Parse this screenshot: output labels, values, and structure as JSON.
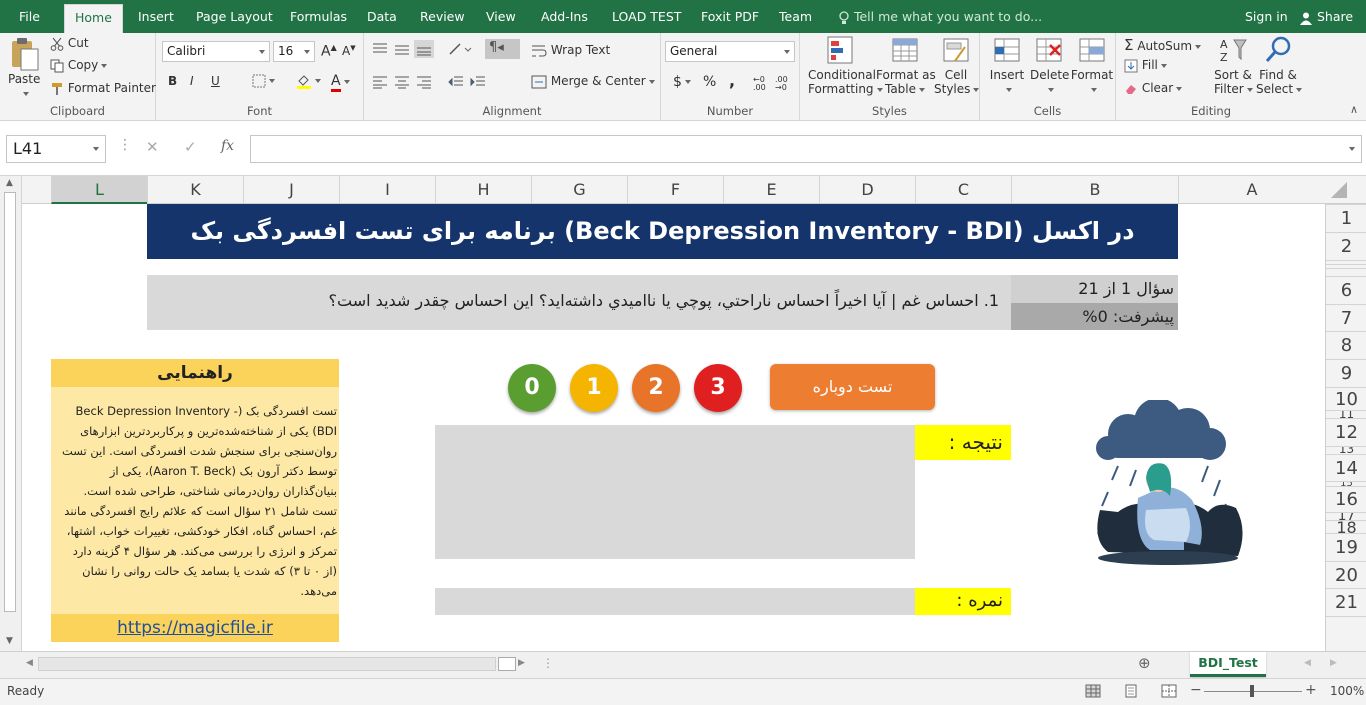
{
  "menu": {
    "tabs": [
      "File",
      "Home",
      "Insert",
      "Page Layout",
      "Formulas",
      "Data",
      "Review",
      "View",
      "Add-Ins",
      "LOAD TEST",
      "Foxit PDF",
      "Team"
    ],
    "tell_me": "Tell me what you want to do...",
    "sign_in": "Sign in",
    "share": "Share"
  },
  "ribbon": {
    "clipboard": {
      "label": "Clipboard",
      "paste": "Paste",
      "cut": "Cut",
      "copy": "Copy",
      "format_painter": "Format Painter"
    },
    "font": {
      "label": "Font",
      "name": "Calibri",
      "size": "16",
      "bold": "B",
      "italic": "I",
      "underline": "U"
    },
    "alignment": {
      "label": "Alignment",
      "wrap": "Wrap Text",
      "merge": "Merge & Center"
    },
    "number": {
      "label": "Number",
      "format": "General",
      "currency": "$",
      "percent": "%",
      "comma": ","
    },
    "styles": {
      "label": "Styles",
      "cond1": "Conditional",
      "cond2": "Formatting",
      "fmt1": "Format as",
      "fmt2": "Table",
      "cell1": "Cell",
      "cell2": "Styles"
    },
    "cells": {
      "label": "Cells",
      "insert": "Insert",
      "delete": "Delete",
      "format": "Format"
    },
    "editing": {
      "label": "Editing",
      "autosum": "AutoSum",
      "fill": "Fill",
      "clear": "Clear",
      "sort1": "Sort &",
      "sort2": "Filter",
      "find1": "Find &",
      "find2": "Select"
    }
  },
  "formula_bar": {
    "name_box": "L41",
    "fx": "fx",
    "value": ""
  },
  "columns": [
    "L",
    "K",
    "J",
    "I",
    "H",
    "G",
    "F",
    "E",
    "D",
    "C",
    "B",
    "A"
  ],
  "rows": [
    "1",
    "2",
    "6",
    "7",
    "8",
    "9",
    "10",
    "11",
    "12",
    "13",
    "14",
    "15",
    "16",
    "17",
    "18",
    "19",
    "20",
    "21"
  ],
  "sheet": {
    "banner": "برنامه برای تست افسردگی بک (Beck Depression Inventory - BDI) در اکسل",
    "question": "1. احساس غم | آيا اخيراً احساس ناراحتي، پوچي يا نااميدي داشته‌ايد؟ اين احساس چقدر شديد است؟",
    "question_num": "سؤال 1 از 21",
    "progress": "پیشرفت: 0%",
    "guide_title": "راهنمایی",
    "guide_text": "تست افسردگی بک (Beck Depression Inventory - BDI) یکی از شناخته‌شده‌ترین و پرکاربردترین ابزارهای روان‌سنجی برای سنجش شدت افسردگی است. این تست توسط دکتر آرون بک (Aaron T. Beck)، یکی از بنیان‌گذاران روان‌درمانی شناختی، طراحی شده است. تست شامل ۲۱ سؤال است که علائم رایج افسردگی مانند غم، احساس گناه، افکار خودکشی، تغییرات خواب، اشتها، تمرکز و انرژی را بررسی می‌کند. هر سؤال ۴ گزینه دارد (از ۰ تا ۳) که شدت یا بسامد یک حالت روانی را نشان می‌دهد.",
    "guide_link": "https://magicfile.ir",
    "options": [
      {
        "label": "0",
        "color": "#5a9e32"
      },
      {
        "label": "1",
        "color": "#f4b400"
      },
      {
        "label": "2",
        "color": "#e8742a"
      },
      {
        "label": "3",
        "color": "#e02020"
      }
    ],
    "retry": "تست دوباره",
    "result_label": "نتیجه :",
    "score_label": "نمره :"
  },
  "sheet_tab": "BDI_Test",
  "status": {
    "ready": "Ready",
    "zoom": "100%"
  }
}
